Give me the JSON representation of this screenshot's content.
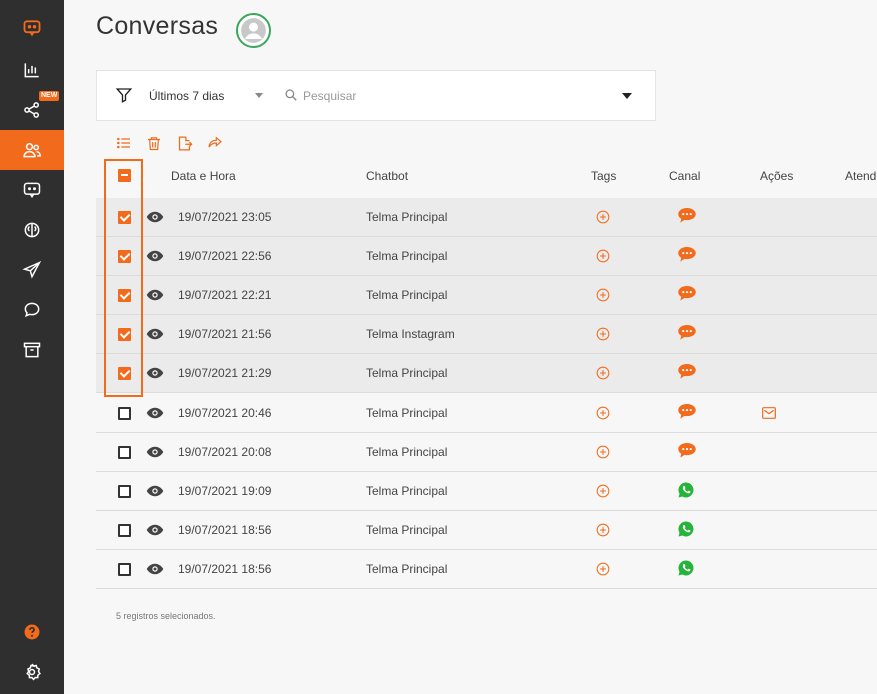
{
  "page": {
    "title": "Conversas"
  },
  "filter": {
    "period_label": "Últimos 7 dias",
    "search_placeholder": "Pesquisar"
  },
  "sidebar": {
    "new_badge": "NEW",
    "items": [
      {
        "icon": "chat-bot-logo-icon"
      },
      {
        "icon": "bar-chart-icon"
      },
      {
        "icon": "share-nodes-icon"
      },
      {
        "icon": "users-icon",
        "active": true
      },
      {
        "icon": "chat-bot-icon"
      },
      {
        "icon": "brain-icon"
      },
      {
        "icon": "send-icon"
      },
      {
        "icon": "chat-bubble-icon"
      },
      {
        "icon": "archive-icon"
      }
    ],
    "bottom_items": [
      {
        "icon": "help-icon"
      },
      {
        "icon": "settings-icon"
      }
    ]
  },
  "table": {
    "columns": {
      "date": "Data e Hora",
      "chatbot": "Chatbot",
      "tags": "Tags",
      "channel": "Canal",
      "actions": "Ações",
      "attendant": "Atend"
    },
    "rows": [
      {
        "date": "19/07/2021 23:05",
        "chatbot": "Telma Principal",
        "channel": "chat",
        "selected": true
      },
      {
        "date": "19/07/2021 22:56",
        "chatbot": "Telma Principal",
        "channel": "chat",
        "selected": true
      },
      {
        "date": "19/07/2021 22:21",
        "chatbot": "Telma Principal",
        "channel": "chat",
        "selected": true
      },
      {
        "date": "19/07/2021 21:56",
        "chatbot": "Telma Instagram",
        "channel": "chat",
        "selected": true
      },
      {
        "date": "19/07/2021 21:29",
        "chatbot": "Telma Principal",
        "channel": "chat",
        "selected": true
      },
      {
        "date": "19/07/2021 20:46",
        "chatbot": "Telma Principal",
        "channel": "chat",
        "selected": false,
        "action": "email"
      },
      {
        "date": "19/07/2021 20:08",
        "chatbot": "Telma Principal",
        "channel": "chat",
        "selected": false
      },
      {
        "date": "19/07/2021 19:09",
        "chatbot": "Telma Principal",
        "channel": "whatsapp",
        "selected": false
      },
      {
        "date": "19/07/2021 18:56",
        "chatbot": "Telma Principal",
        "channel": "whatsapp",
        "selected": false
      },
      {
        "date": "19/07/2021 18:56",
        "chatbot": "Telma Principal",
        "channel": "whatsapp",
        "selected": false
      }
    ]
  },
  "footer": {
    "selection_summary": "5 registros selecionados."
  },
  "colors": {
    "accent": "#f26a1b",
    "sidebar": "#2f2f2f",
    "whatsapp": "#25b33a",
    "avatar_ring": "#3aa65a"
  }
}
